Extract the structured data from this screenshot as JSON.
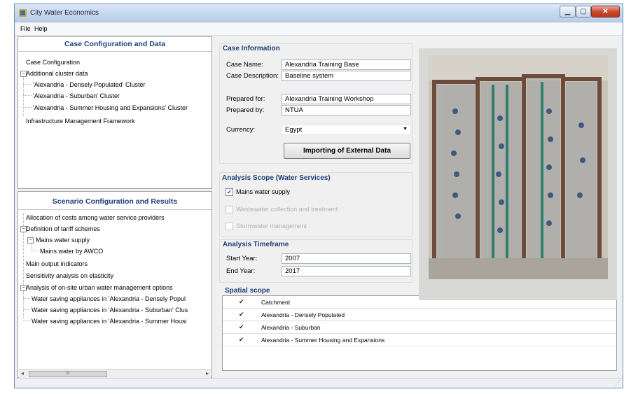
{
  "window": {
    "title": "City Water Economics"
  },
  "menu": [
    "File",
    "Help"
  ],
  "case_panel": {
    "title": "Case Configuration and Data",
    "tree": [
      "Case Configuration",
      "Additional cluster data",
      "'Alexandria - Densely Populated' Cluster",
      "'Alexandria - Suburban' Cluster",
      "'Alexandria - Summer Housing and Expansions' Cluster",
      "Infrastructure Management Framework"
    ]
  },
  "scenario_panel": {
    "title": "Scenario Configuration and Results",
    "tree": [
      "Allocation of costs among water service providers",
      "Definition of tariff schemes",
      "Mains water supply",
      "Mains water by AWCO",
      "Main output indicators",
      "Sensitivity analysis on elasticity",
      "Analysis of on-site urban water management options",
      "Water saving appliances in 'Alexandria - Densely Popul",
      "Water saving appliances in 'Alexandria - Suburban' Clus",
      "Water saving appliances in 'Alexandria - Summer Housi"
    ],
    "scrollbar_label": "III"
  },
  "case_info": {
    "title": "Case Information",
    "fields": [
      {
        "label": "Case Name:",
        "value": "Alexandria Training Base"
      },
      {
        "label": "Case Description:",
        "value": "Baseline system"
      },
      {
        "label": "Prepared for:",
        "value": "Alexandria Training Workshop"
      },
      {
        "label": "Prepared by:",
        "value": "NTUA"
      }
    ],
    "currency_label": "Currency:",
    "currency_value": "Egypt",
    "import_button": "Importing of External Data"
  },
  "analysis_scope": {
    "title": "Analysis Scope (Water Services)",
    "options": [
      {
        "label": "Mains water supply",
        "checked": true,
        "enabled": true
      },
      {
        "label": "Wastewater collection and treatment",
        "checked": false,
        "enabled": false
      },
      {
        "label": "Stormwater management",
        "checked": false,
        "enabled": false
      }
    ]
  },
  "timeframe": {
    "title": "Analysis Timeframe",
    "start_label": "Start Year:",
    "start_value": "2007",
    "end_label": "End Year:",
    "end_value": "2017"
  },
  "spatial_scope": {
    "title": "Spatial scope",
    "rows": [
      {
        "label": "Catchment",
        "checked": true
      },
      {
        "label": "Alexandria - Densely Populated",
        "checked": true
      },
      {
        "label": "Alexandria - Suburban",
        "checked": true
      },
      {
        "label": "Alexandria - Summer Housing and Expansions",
        "checked": true
      }
    ]
  },
  "colors": {
    "header_blue": "#1f3f7a",
    "titlebar": "#c5d7ee",
    "close_red": "#c8462c"
  }
}
